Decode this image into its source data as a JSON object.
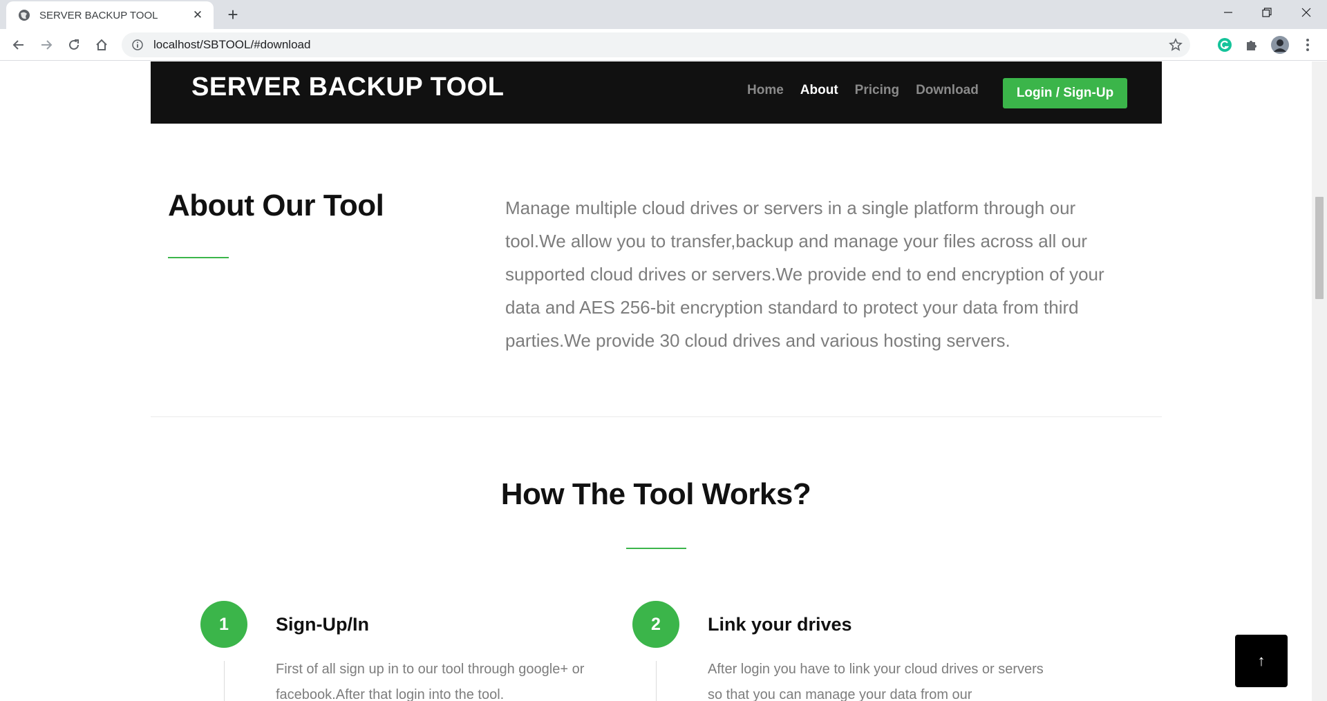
{
  "browser": {
    "tab_title": "SERVER BACKUP TOOL",
    "url": "localhost/SBTOOL/#download",
    "icons": [
      "globe-icon",
      "close-icon",
      "plus-icon",
      "minimize-icon",
      "restore-icon",
      "window-close-icon",
      "back-icon",
      "forward-icon",
      "reload-icon",
      "home-icon",
      "info-icon",
      "star-icon",
      "grammarly-icon",
      "extensions-icon",
      "profile-avatar",
      "menu-icon"
    ]
  },
  "header": {
    "brand": "SERVER BACKUP TOOL",
    "nav": [
      {
        "label": "Home",
        "active": false
      },
      {
        "label": "About",
        "active": true
      },
      {
        "label": "Pricing",
        "active": false
      },
      {
        "label": "Download",
        "active": false
      }
    ],
    "cta": "Login / Sign-Up"
  },
  "about": {
    "title": "About Our Tool",
    "text": "Manage multiple cloud drives or servers in a single platform through our tool.We allow you to transfer,backup and manage your files across all our supported cloud drives or servers.We provide end to end encryption of your data and AES 256-bit encryption standard to protect your data from third parties.We provide 30 cloud drives and various hosting servers."
  },
  "how": {
    "title": "How The Tool Works?",
    "steps": [
      {
        "number": "1",
        "title": "Sign-Up/In",
        "desc": "First of all sign up in to our tool through google+ or facebook.After that login into the tool."
      },
      {
        "number": "2",
        "title": "Link your drives",
        "desc": "After login you have to link your cloud drives or servers so that you can manage your data from our"
      }
    ]
  },
  "scroll_top": "↑",
  "colors": {
    "accent": "#3bb54a",
    "header_bg": "#111111",
    "muted_text": "#7d7d7d"
  }
}
